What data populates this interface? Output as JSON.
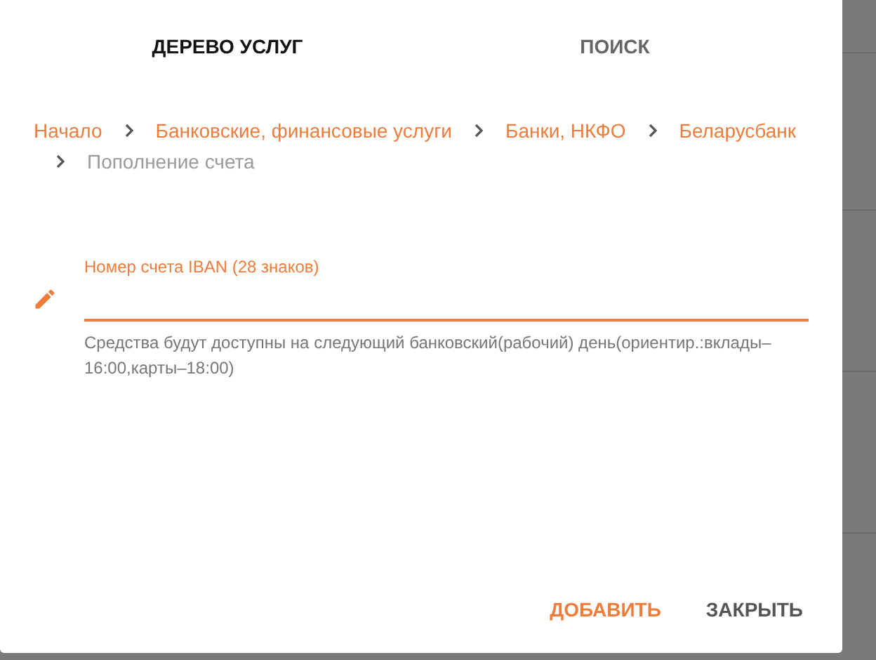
{
  "tabs": [
    {
      "label": "ДЕРЕВО УСЛУГ",
      "selected": true
    },
    {
      "label": "ПОИСК",
      "selected": false
    }
  ],
  "breadcrumb": [
    {
      "label": "Начало",
      "current": false
    },
    {
      "label": "Банковские, финансовые услуги",
      "current": false
    },
    {
      "label": "Банки, НКФО",
      "current": false
    },
    {
      "label": "Беларусбанк",
      "current": false
    },
    {
      "label": "Пополнение счета",
      "current": true
    }
  ],
  "field": {
    "label": "Номер счета IBAN (28 знаков)",
    "focused": true,
    "helper": "Средства будут доступны на следующий банковский(рабочий) день(ориентир.:вклады–16:00,карты–18:00)"
  },
  "buttons": [
    {
      "label": "ДОБАВИТЬ",
      "kind": "primary"
    },
    {
      "label": "ЗАКРЫТЬ",
      "kind": "secondary"
    }
  ]
}
